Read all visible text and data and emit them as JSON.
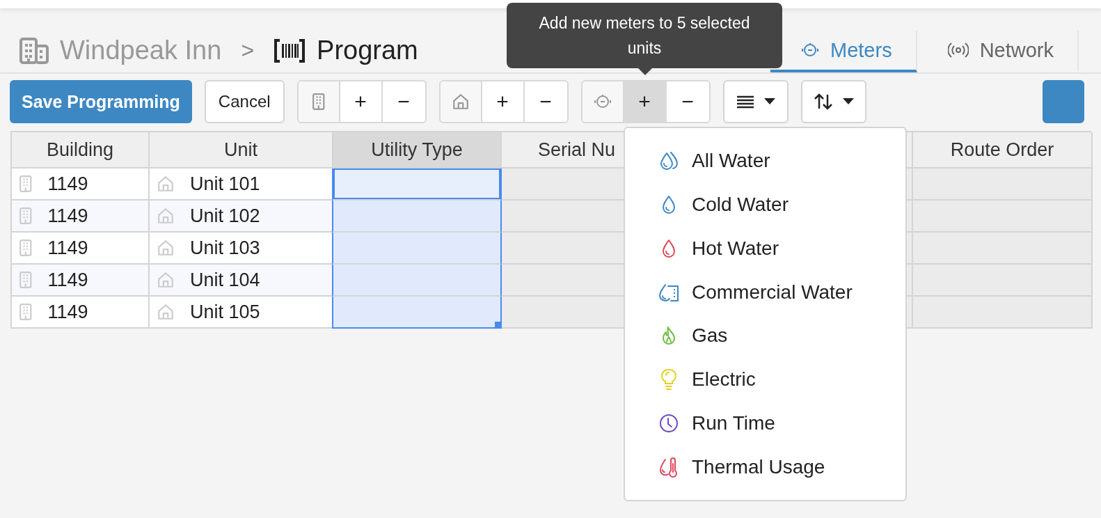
{
  "breadcrumb": {
    "property": "Windpeak Inn",
    "separator": ">",
    "page": "Program"
  },
  "tabs": [
    {
      "label": "Meters",
      "kind": "meter",
      "selected": true
    },
    {
      "label": "Network",
      "kind": "signal",
      "selected": false
    }
  ],
  "tooltip": "Add new meters to 5 selected units",
  "toolbar": {
    "save": "Save Programming",
    "cancel": "Cancel",
    "groups": [
      {
        "kind": "building",
        "buttons": [
          {
            "label": "+",
            "hovered": false
          },
          {
            "label": "−",
            "hovered": false
          }
        ]
      },
      {
        "kind": "home",
        "buttons": [
          {
            "label": "+",
            "hovered": false
          },
          {
            "label": "−",
            "hovered": false
          }
        ]
      },
      {
        "kind": "meter",
        "buttons": [
          {
            "label": "+",
            "hovered": true
          },
          {
            "label": "−",
            "hovered": false
          }
        ]
      }
    ],
    "menus": [
      {
        "kind": "lines"
      },
      {
        "kind": "sort"
      }
    ]
  },
  "table": {
    "columns": [
      {
        "label": "Building",
        "selected": false
      },
      {
        "label": "Unit",
        "selected": false
      },
      {
        "label": "Utility Type",
        "selected": true
      },
      {
        "label": "Serial Nu",
        "selected": false
      },
      {
        "label": "Route Order",
        "selected": false
      }
    ],
    "rows": [
      {
        "building": "1149",
        "unit": "Unit 101",
        "selected": true,
        "active": true
      },
      {
        "building": "1149",
        "unit": "Unit 102",
        "selected": true,
        "active": false
      },
      {
        "building": "1149",
        "unit": "Unit 103",
        "selected": true,
        "active": false
      },
      {
        "building": "1149",
        "unit": "Unit 104",
        "selected": true,
        "active": false
      },
      {
        "building": "1149",
        "unit": "Unit 105",
        "selected": true,
        "active": false
      }
    ]
  },
  "menu": [
    {
      "label": "All Water",
      "kind": "drops",
      "color": "#3d88c8"
    },
    {
      "label": "Cold Water",
      "kind": "drop",
      "color": "#3d88c8"
    },
    {
      "label": "Hot Water",
      "kind": "drop",
      "color": "#e0475a"
    },
    {
      "label": "Commercial Water",
      "kind": "commercial",
      "color": "#3d88c8"
    },
    {
      "label": "Gas",
      "kind": "flame",
      "color": "#6cbd3c"
    },
    {
      "label": "Electric",
      "kind": "bulb",
      "color": "#e6cf1c"
    },
    {
      "label": "Run Time",
      "kind": "clock",
      "color": "#7048c8"
    },
    {
      "label": "Thermal Usage",
      "kind": "thermal",
      "color": "#e0475a"
    }
  ]
}
